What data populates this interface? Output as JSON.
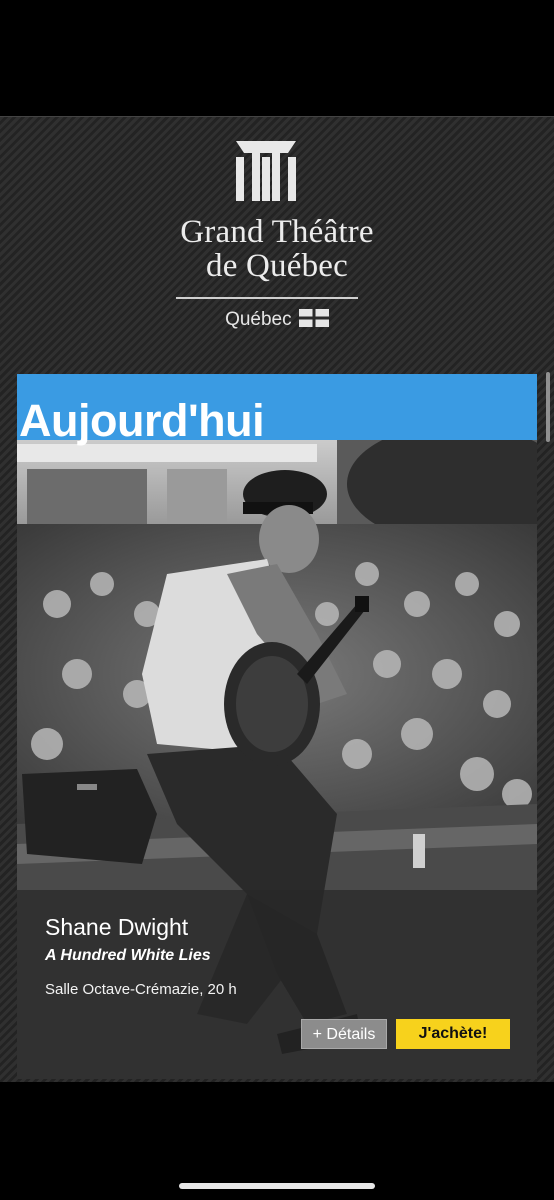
{
  "header": {
    "brand_line1": "Grand Théâtre",
    "brand_line2": "de Québec",
    "sponsor": "Québec"
  },
  "featured": {
    "banner": "Aujourd'hui",
    "artist": "Shane Dwight",
    "show_title": "A Hundred White Lies",
    "venue_time": "Salle Octave-Crémazie, 20 h",
    "details_label": "+ Détails",
    "buy_label": "J'achète!",
    "photo_alt": "Shane Dwight"
  },
  "colors": {
    "banner_blue": "#3a9be3",
    "buy_yellow": "#f7d21c",
    "details_gray": "#8c8c8c"
  }
}
